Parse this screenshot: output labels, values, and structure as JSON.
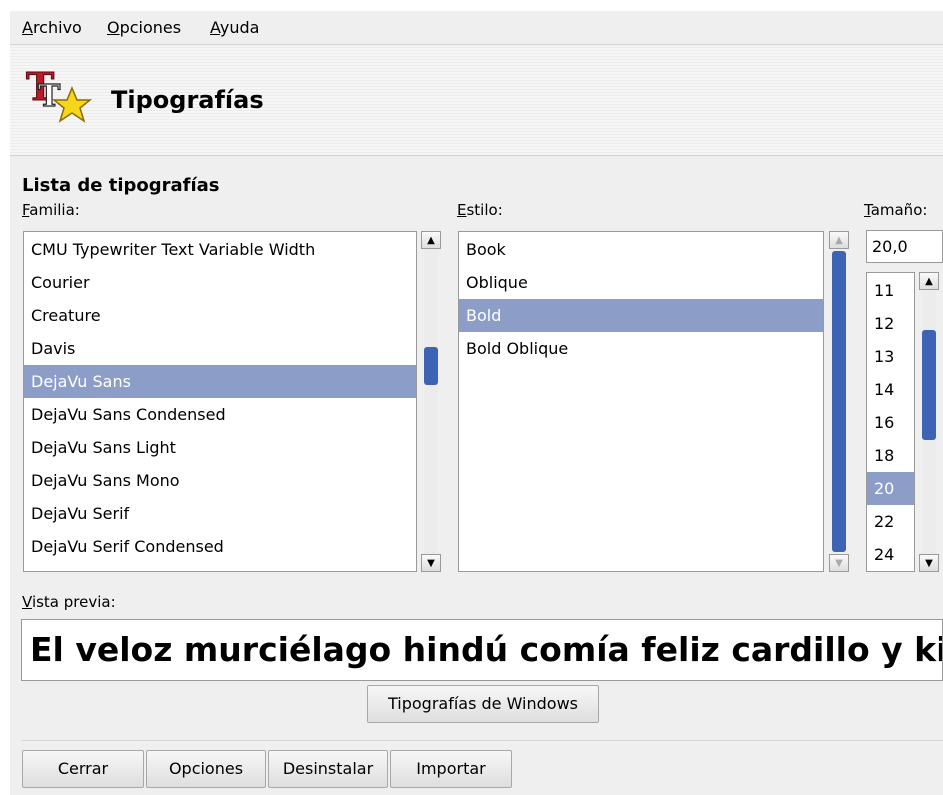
{
  "menu": {
    "items": [
      {
        "mnemonic": "A",
        "rest": "rchivo"
      },
      {
        "mnemonic": "O",
        "rest": "pciones"
      },
      {
        "mnemonic": "A",
        "rest": "yuda"
      }
    ]
  },
  "header": {
    "title": "Tipografías",
    "icon": "font-star-icon"
  },
  "section": {
    "title": "Lista de tipografías"
  },
  "family": {
    "label_mnemonic": "F",
    "label_rest": "amilia:",
    "items": [
      "CMU Typewriter Text Variable Width",
      "Courier",
      "Creature",
      "Davis",
      "DejaVu Sans",
      "DejaVu Sans Condensed",
      "DejaVu Sans Light",
      "DejaVu Sans Mono",
      "DejaVu Serif",
      "DejaVu Serif Condensed"
    ],
    "selected": "DejaVu Sans"
  },
  "style": {
    "label_mnemonic": "E",
    "label_rest": "stilo:",
    "items": [
      "Book",
      "Oblique",
      "Bold",
      "Bold Oblique"
    ],
    "selected": "Bold"
  },
  "size": {
    "label_mnemonic": "T",
    "label_rest": "amaño:",
    "value": "20,0",
    "items": [
      "11",
      "12",
      "13",
      "14",
      "16",
      "18",
      "20",
      "22",
      "24"
    ],
    "selected": "20"
  },
  "preview": {
    "label_mnemonic": "V",
    "label_rest": "ista previa:",
    "text": "El veloz murciélago hindú comía feliz cardillo y kiwi"
  },
  "buttons": {
    "windows_fonts": "Tipografías de Windows",
    "close": "Cerrar",
    "options": "Opciones",
    "uninstall": "Desinstalar",
    "import": "Importar"
  },
  "colors": {
    "selection": "#8c9dc8",
    "scroll_thumb": "#3d63b5",
    "window_bg": "#efefef"
  }
}
